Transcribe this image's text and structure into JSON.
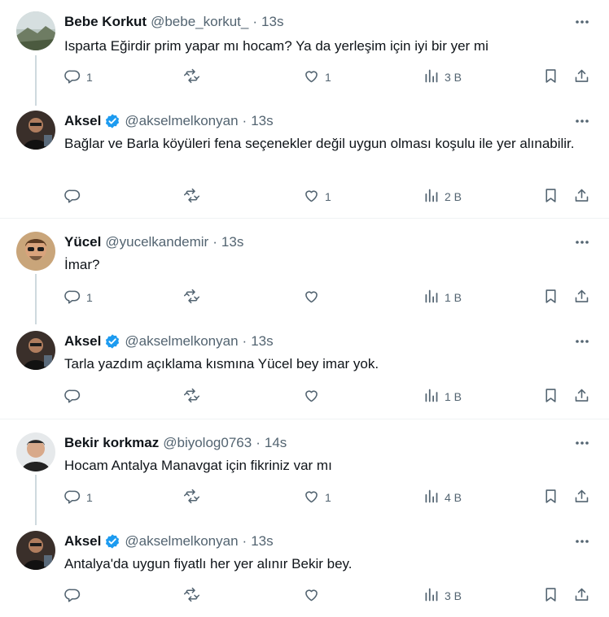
{
  "colors": {
    "accent": "#1d9bf0",
    "muted": "#536471",
    "text": "#0f1419",
    "line": "#cfd9de"
  },
  "tweets": [
    {
      "name": "Bebe Korkut",
      "handle": "@bebe_korkut_",
      "time": "13s",
      "verified": false,
      "text": "Isparta Eğirdir prim yapar mı hocam? Ya da yerleşim için iyi bir yer mi",
      "replies": "1",
      "retweets": "",
      "likes": "1",
      "views": "3 B"
    },
    {
      "name": "Aksel",
      "handle": "@akselmelkonyan",
      "time": "13s",
      "verified": true,
      "text": "Bağlar ve Barla köyüleri fena seçenekler değil uygun olması koşulu ile yer alınabilir.",
      "replies": "",
      "retweets": "",
      "likes": "1",
      "views": "2 B"
    },
    {
      "name": "Yücel",
      "handle": "@yucelkandemir",
      "time": "13s",
      "verified": false,
      "text": "İmar?",
      "replies": "1",
      "retweets": "",
      "likes": "",
      "views": "1 B"
    },
    {
      "name": "Aksel",
      "handle": "@akselmelkonyan",
      "time": "13s",
      "verified": true,
      "text": "Tarla yazdım açıklama kısmına Yücel bey imar yok.",
      "replies": "",
      "retweets": "",
      "likes": "",
      "views": "1 B"
    },
    {
      "name": "Bekir korkmaz",
      "handle": "@biyolog0763",
      "time": "14s",
      "verified": false,
      "text": "Hocam Antalya Manavgat için  fikriniz var mı",
      "replies": "1",
      "retweets": "",
      "likes": "1",
      "views": "4 B"
    },
    {
      "name": "Aksel",
      "handle": "@akselmelkonyan",
      "time": "13s",
      "verified": true,
      "text": "Antalya'da uygun fiyatlı her yer alınır Bekir bey.",
      "replies": "",
      "retweets": "",
      "likes": "",
      "views": "3 B"
    }
  ],
  "separator": "·"
}
